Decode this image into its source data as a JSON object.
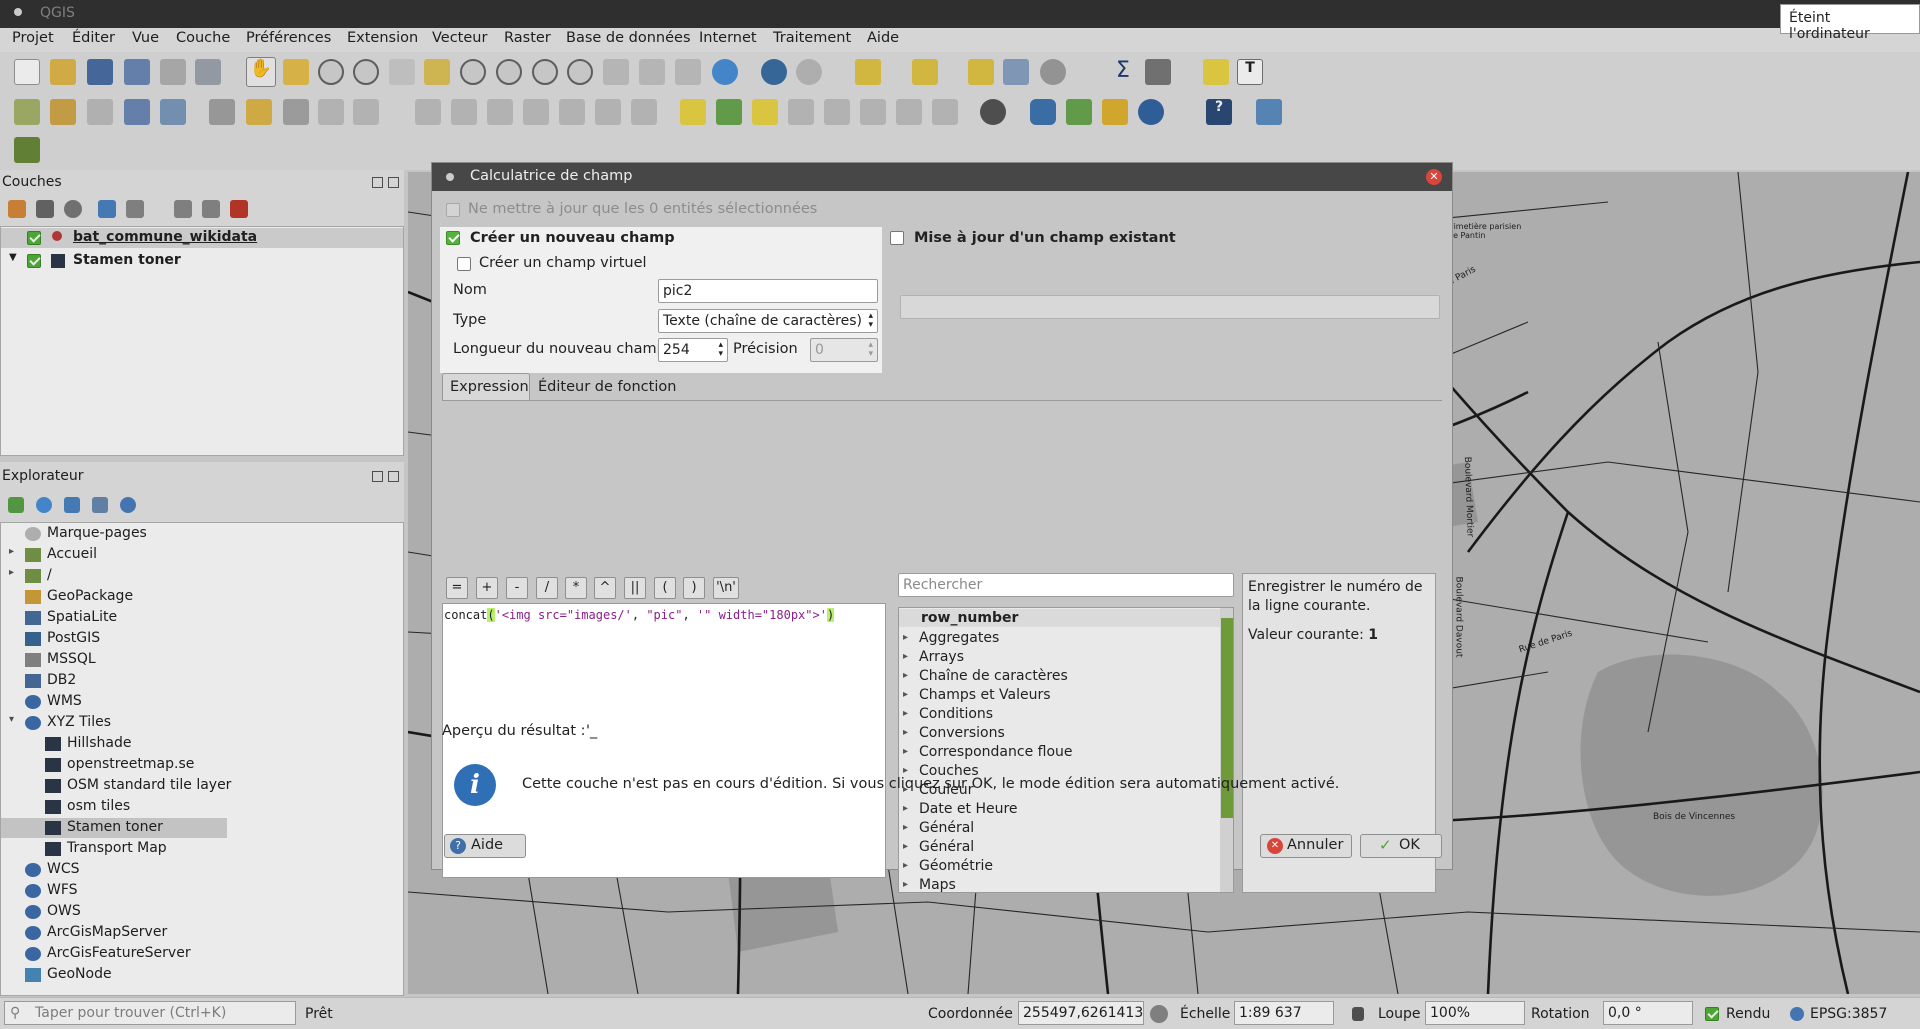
{
  "window": {
    "title": "QGIS",
    "tooltip": "Éteint l'ordinateur"
  },
  "menu": [
    "Projet",
    "Éditer",
    "Vue",
    "Couche",
    "Préférences",
    "Extension",
    "Vecteur",
    "Raster",
    "Base de données",
    "Internet",
    "Traitement",
    "Aide"
  ],
  "layers_panel": {
    "title": "Couches",
    "items": [
      {
        "label": "bat_commune_wikidata",
        "checked": true,
        "icon": "point-layer-icon"
      },
      {
        "label": "Stamen toner",
        "checked": true,
        "icon": "raster-tile-icon"
      }
    ]
  },
  "browser_panel": {
    "title": "Explorateur",
    "items": [
      {
        "label": "Marque-pages",
        "icon": "star-icon"
      },
      {
        "label": "Accueil",
        "icon": "folder-icon"
      },
      {
        "label": "/",
        "icon": "folder-icon"
      },
      {
        "label": "GeoPackage",
        "icon": "geopackage-icon"
      },
      {
        "label": "SpatiaLite",
        "icon": "spatialite-icon"
      },
      {
        "label": "PostGIS",
        "icon": "postgis-icon"
      },
      {
        "label": "MSSQL",
        "icon": "mssql-icon"
      },
      {
        "label": "DB2",
        "icon": "db2-icon"
      },
      {
        "label": "WMS",
        "icon": "globe-icon"
      },
      {
        "label": "XYZ Tiles",
        "icon": "globe-icon"
      },
      {
        "label": "Hillshade",
        "icon": "tile-icon"
      },
      {
        "label": "openstreetmap.se",
        "icon": "tile-icon"
      },
      {
        "label": "OSM standard tile layer",
        "icon": "tile-icon"
      },
      {
        "label": "osm tiles",
        "icon": "tile-icon"
      },
      {
        "label": "Stamen toner",
        "icon": "tile-icon"
      },
      {
        "label": "Transport Map",
        "icon": "tile-icon"
      },
      {
        "label": "WCS",
        "icon": "globe-icon"
      },
      {
        "label": "WFS",
        "icon": "globe-icon"
      },
      {
        "label": "OWS",
        "icon": "globe-icon"
      },
      {
        "label": "ArcGisMapServer",
        "icon": "globe-icon"
      },
      {
        "label": "ArcGisFeatureServer",
        "icon": "globe-icon"
      },
      {
        "label": "GeoNode",
        "icon": "geonode-icon"
      }
    ]
  },
  "map": {
    "labels": [
      "Rue de Paris",
      "Rue de Paris",
      "Boulevard Mortier",
      "Boulevard Davout",
      "Bois de Vincennes",
      "Cimetière parisien de Pantin"
    ]
  },
  "dialog": {
    "title": "Calculatrice de champ",
    "only_selected": "Ne mettre à jour que les 0 entités sélectionnées",
    "create_new": "Créer un nouveau champ",
    "create_virtual": "Créer un champ virtuel",
    "update_existing": "Mise à jour d'un champ existant",
    "name_label": "Nom",
    "name_value": "pic2",
    "type_label": "Type",
    "type_value": "Texte (chaîne de caractères)",
    "length_label": "Longueur du nouveau champ",
    "length_value": "254",
    "precision_label": "Précision",
    "precision_value": "0",
    "tabs": [
      "Expression",
      "Éditeur de fonction"
    ],
    "operators": [
      "=",
      "+",
      "-",
      "/",
      "*",
      "^",
      "||",
      "(",
      ")",
      "'\\n'"
    ],
    "expression": {
      "func": "concat",
      "open": "(",
      "s1": "'<img src=\"images/'",
      "sep1": ", ",
      "s2": "\"pic\"",
      "sep2": ", ",
      "s3": "'\" width=\"180px\">'",
      "close": ")"
    },
    "search_placeholder": "Rechercher",
    "functions": [
      "row_number",
      "Aggregates",
      "Arrays",
      "Chaîne de caractères",
      "Champs et Valeurs",
      "Conditions",
      "Conversions",
      "Correspondance floue",
      "Couches",
      "Couleur",
      "Date et Heure",
      "Général",
      "Général",
      "Géométrie",
      "Maps"
    ],
    "help_text": "Enregistrer le numéro de la ligne courante.",
    "current_value_label": "Valeur courante:",
    "current_value": "1",
    "preview_label": "Aperçu du résultat :",
    "preview_value": "'_",
    "info_message": "Cette couche n'est pas en cours d'édition. Si vous cliquez sur OK, le mode édition sera automatiquement activé.",
    "help_button": "Aide",
    "cancel_button": "Annuler",
    "ok_button": "OK"
  },
  "status": {
    "search_placeholder": "Taper pour trouver (Ctrl+K)",
    "ready": "Prêt",
    "coord_label": "Coordonnée",
    "coord_value": "255497,6261413",
    "scale_label": "Échelle",
    "scale_value": "1:89 637",
    "magnifier_label": "Loupe",
    "magnifier_value": "100%",
    "rotation_label": "Rotation",
    "rotation_value": "0,0 °",
    "render_label": "Rendu",
    "crs": "EPSG:3857"
  },
  "colors": {
    "accent_green": "#54b33a",
    "selection": "#c8c8c8",
    "title_bar": "#474747"
  }
}
